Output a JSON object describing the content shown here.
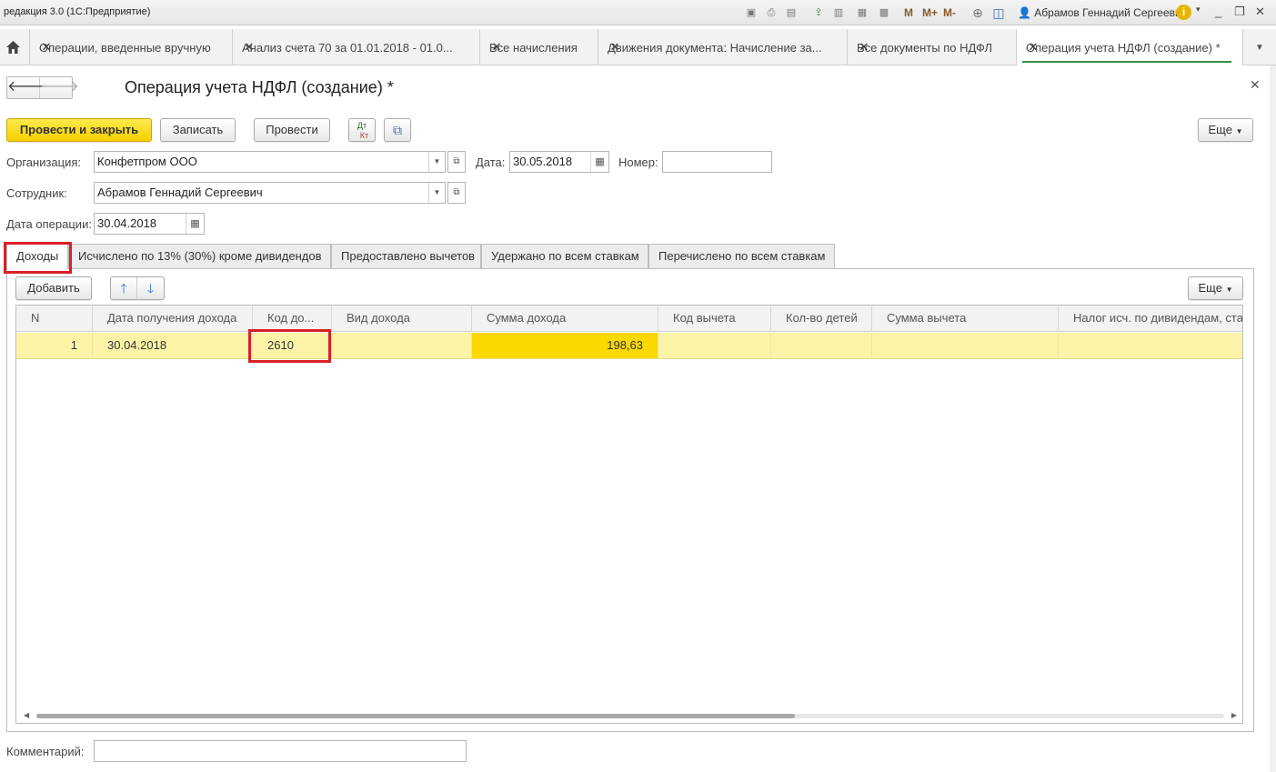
{
  "titlebar": {
    "title": "редакция 3.0  (1С:Предприятие)",
    "m": "M",
    "m_plus": "M+",
    "m_minus": "M-",
    "user": "Абрамов Геннадий Сергеевич",
    "info": "i"
  },
  "open_tabs": [
    {
      "label": "Операции, введенные вручную"
    },
    {
      "label": "Анализ счета 70 за 01.01.2018 - 01.0..."
    },
    {
      "label": "Все начисления"
    },
    {
      "label": "Движения документа: Начисление за..."
    },
    {
      "label": "Все документы по НДФЛ"
    },
    {
      "label": "Операция учета НДФЛ (создание) *"
    }
  ],
  "form": {
    "title": "Операция учета НДФЛ (создание) *"
  },
  "toolbar": {
    "post_close": "Провести и закрыть",
    "save": "Записать",
    "post": "Провести",
    "dt_kt": "Дт Кт",
    "more": "Еще"
  },
  "fields": {
    "org_label": "Организация:",
    "org_value": "Конфетпром ООО",
    "date_label": "Дата:",
    "date_value": "30.05.2018",
    "number_label": "Номер:",
    "number_value": "",
    "employee_label": "Сотрудник:",
    "employee_value": "Абрамов Геннадий Сергеевич",
    "op_date_label": "Дата операции:",
    "op_date_value": "30.04.2018",
    "comment_label": "Комментарий:",
    "comment_value": ""
  },
  "page_tabs": [
    "Доходы",
    "Исчислено по 13% (30%) кроме дивидендов",
    "Предоставлено вычетов",
    "Удержано по всем ставкам",
    "Перечислено по всем ставкам"
  ],
  "table_toolbar": {
    "add": "Добавить",
    "more": "Еще"
  },
  "table": {
    "columns": [
      "N",
      "Дата получения дохода",
      "Код до...",
      "Вид дохода",
      "Сумма дохода",
      "Код вычета",
      "Кол-во детей",
      "Сумма вычета",
      "Налог исч. по дивидендам, ста"
    ],
    "rows": [
      {
        "n": "1",
        "date": "30.04.2018",
        "code": "2610",
        "kind": "",
        "sum": "198,63",
        "deduction_code": "",
        "children": "",
        "deduction_sum": "",
        "tax_dividends": ""
      }
    ]
  },
  "colors": {
    "accent_yellow": "#f5cf00",
    "row_highlight": "#fbf3a6",
    "selected_cell": "#f9d900",
    "annotation_red": "#d9202a",
    "active_tab_underline": "#3b8f4a"
  }
}
